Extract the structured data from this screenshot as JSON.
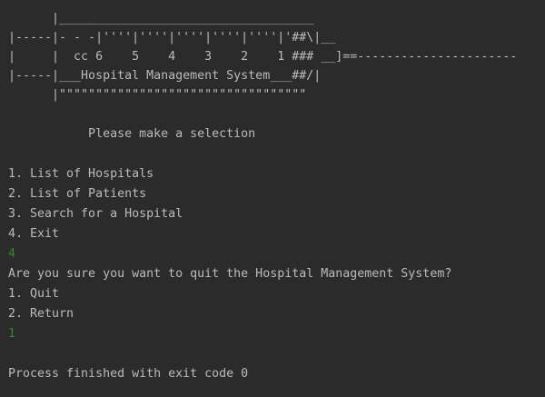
{
  "console": {
    "banner": [
      "      |___________________________________",
      "|-----|- - -|''''|''''|''''|''''|''''|'##\\|__",
      "|     |  cc 6    5    4    3    2    1 ### __]==----------------------",
      "|-----|___Hospital Management System___##/|",
      "      |\"\"\"\"\"\"\"\"\"\"\"\"\"\"\"\"\"\"\"\"\"\"\"\"\"\"\"\"\"\"\"\"\"\""
    ],
    "prompt": "           Please make a selection",
    "menu": [
      "1. List of Hospitals",
      "2. List of Patients",
      "3. Search for a Hospital",
      "4. Exit"
    ],
    "user_input_1": "4",
    "confirm_question": "Are you sure you want to quit the Hospital Management System?",
    "confirm_options": [
      "1. Quit",
      "2. Return"
    ],
    "user_input_2": "1",
    "exit_message": "Process finished with exit code 0"
  },
  "colors": {
    "background": "#2b2b2b",
    "text": "#bbbbbb",
    "user_input": "#2e8b2e"
  }
}
